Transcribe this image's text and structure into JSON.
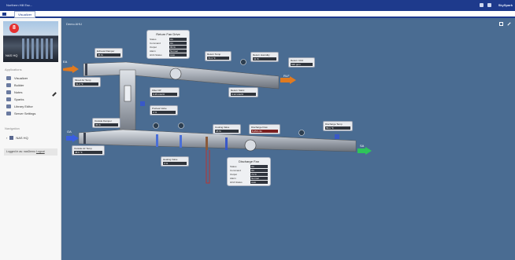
{
  "window": {
    "app_title": "Northern Hill Esc...",
    "tab_label": "Visualizer",
    "user": "SkySpark"
  },
  "site": {
    "caption": "NAS HQ",
    "alarm_count": "8"
  },
  "sidebar": {
    "applications_title": "Applications",
    "items": [
      {
        "label": "Visualizer",
        "icon": "grid-icon"
      },
      {
        "label": "Builder",
        "icon": "builder-icon"
      },
      {
        "label": "Notes",
        "icon": "notes-icon"
      },
      {
        "label": "Sparks",
        "icon": "sparks-icon"
      },
      {
        "label": "Library Editor",
        "icon": "library-icon"
      },
      {
        "label": "Server Settings",
        "icon": "settings-icon"
      }
    ],
    "navigation_title": "Navigation",
    "nav_tree": {
      "label": "NAS HQ"
    },
    "login_text": "Logged in as: nasDemo",
    "logout_label": "Logout"
  },
  "canvas": {
    "title": "Demo AHU",
    "labels": {
      "return_air": "RLF",
      "exhaust": "EA",
      "outside_air": "OA",
      "supply": "SA"
    },
    "return_fan_panel": {
      "title": "Return Fan Drive",
      "rows": [
        {
          "label": "Status",
          "value": "On"
        },
        {
          "label": "Command",
          "value": "On"
        },
        {
          "label": "Output",
          "value": "65 %"
        },
        {
          "label": "Alarm",
          "value": "Normal"
        },
        {
          "label": "HOA Status",
          "value": "Auto"
        }
      ]
    },
    "discharge_fan_panel": {
      "title": "Discharge Fan",
      "rows": [
        {
          "label": "Status",
          "value": "On"
        },
        {
          "label": "Command",
          "value": "On"
        },
        {
          "label": "Output",
          "value": "72 %"
        },
        {
          "label": "Alarm",
          "value": "Normal"
        },
        {
          "label": "HOA Status",
          "value": "Auto"
        }
      ]
    },
    "sensors": [
      {
        "label": "Exhaust Damper",
        "value": "35 %"
      },
      {
        "label": "Return Temp",
        "value": "72.4 °F"
      },
      {
        "label": "Return Humidity",
        "value": "41 %"
      },
      {
        "label": "Return CO2",
        "value": "620 ppm"
      },
      {
        "label": "Return Static",
        "value": "0.12 inH2O"
      },
      {
        "label": "Mixed Air Temp",
        "value": "61.2 °F"
      },
      {
        "label": "Filter DP",
        "value": "0.45 inH2O"
      },
      {
        "label": "Outside Damper",
        "value": "35 %"
      },
      {
        "label": "Outside Air Temp",
        "value": "48.6 °F"
      },
      {
        "label": "Preheat Valve",
        "value": "0 %"
      },
      {
        "label": "Cooling Valve",
        "value": "18 %"
      },
      {
        "label": "Discharge Flow",
        "value": "8,450 cfm"
      },
      {
        "label": "Discharge Temp",
        "value": "55.1 °F"
      },
      {
        "label": "Heating Valve",
        "value": "0 %"
      }
    ]
  }
}
